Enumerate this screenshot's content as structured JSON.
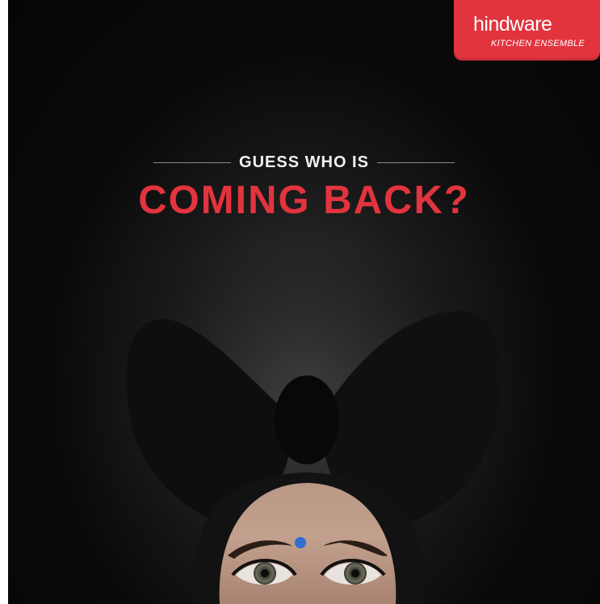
{
  "brand": {
    "name": "hindware",
    "tagline": "KITCHEN ENSEMBLE",
    "color": "#e2343e"
  },
  "headline": {
    "line1": "GUESS WHO IS",
    "line2": "COMING BACK?"
  },
  "colors": {
    "background": "#0a0a0a",
    "accent": "#e2343e",
    "bindi": "#2f6fd1"
  }
}
